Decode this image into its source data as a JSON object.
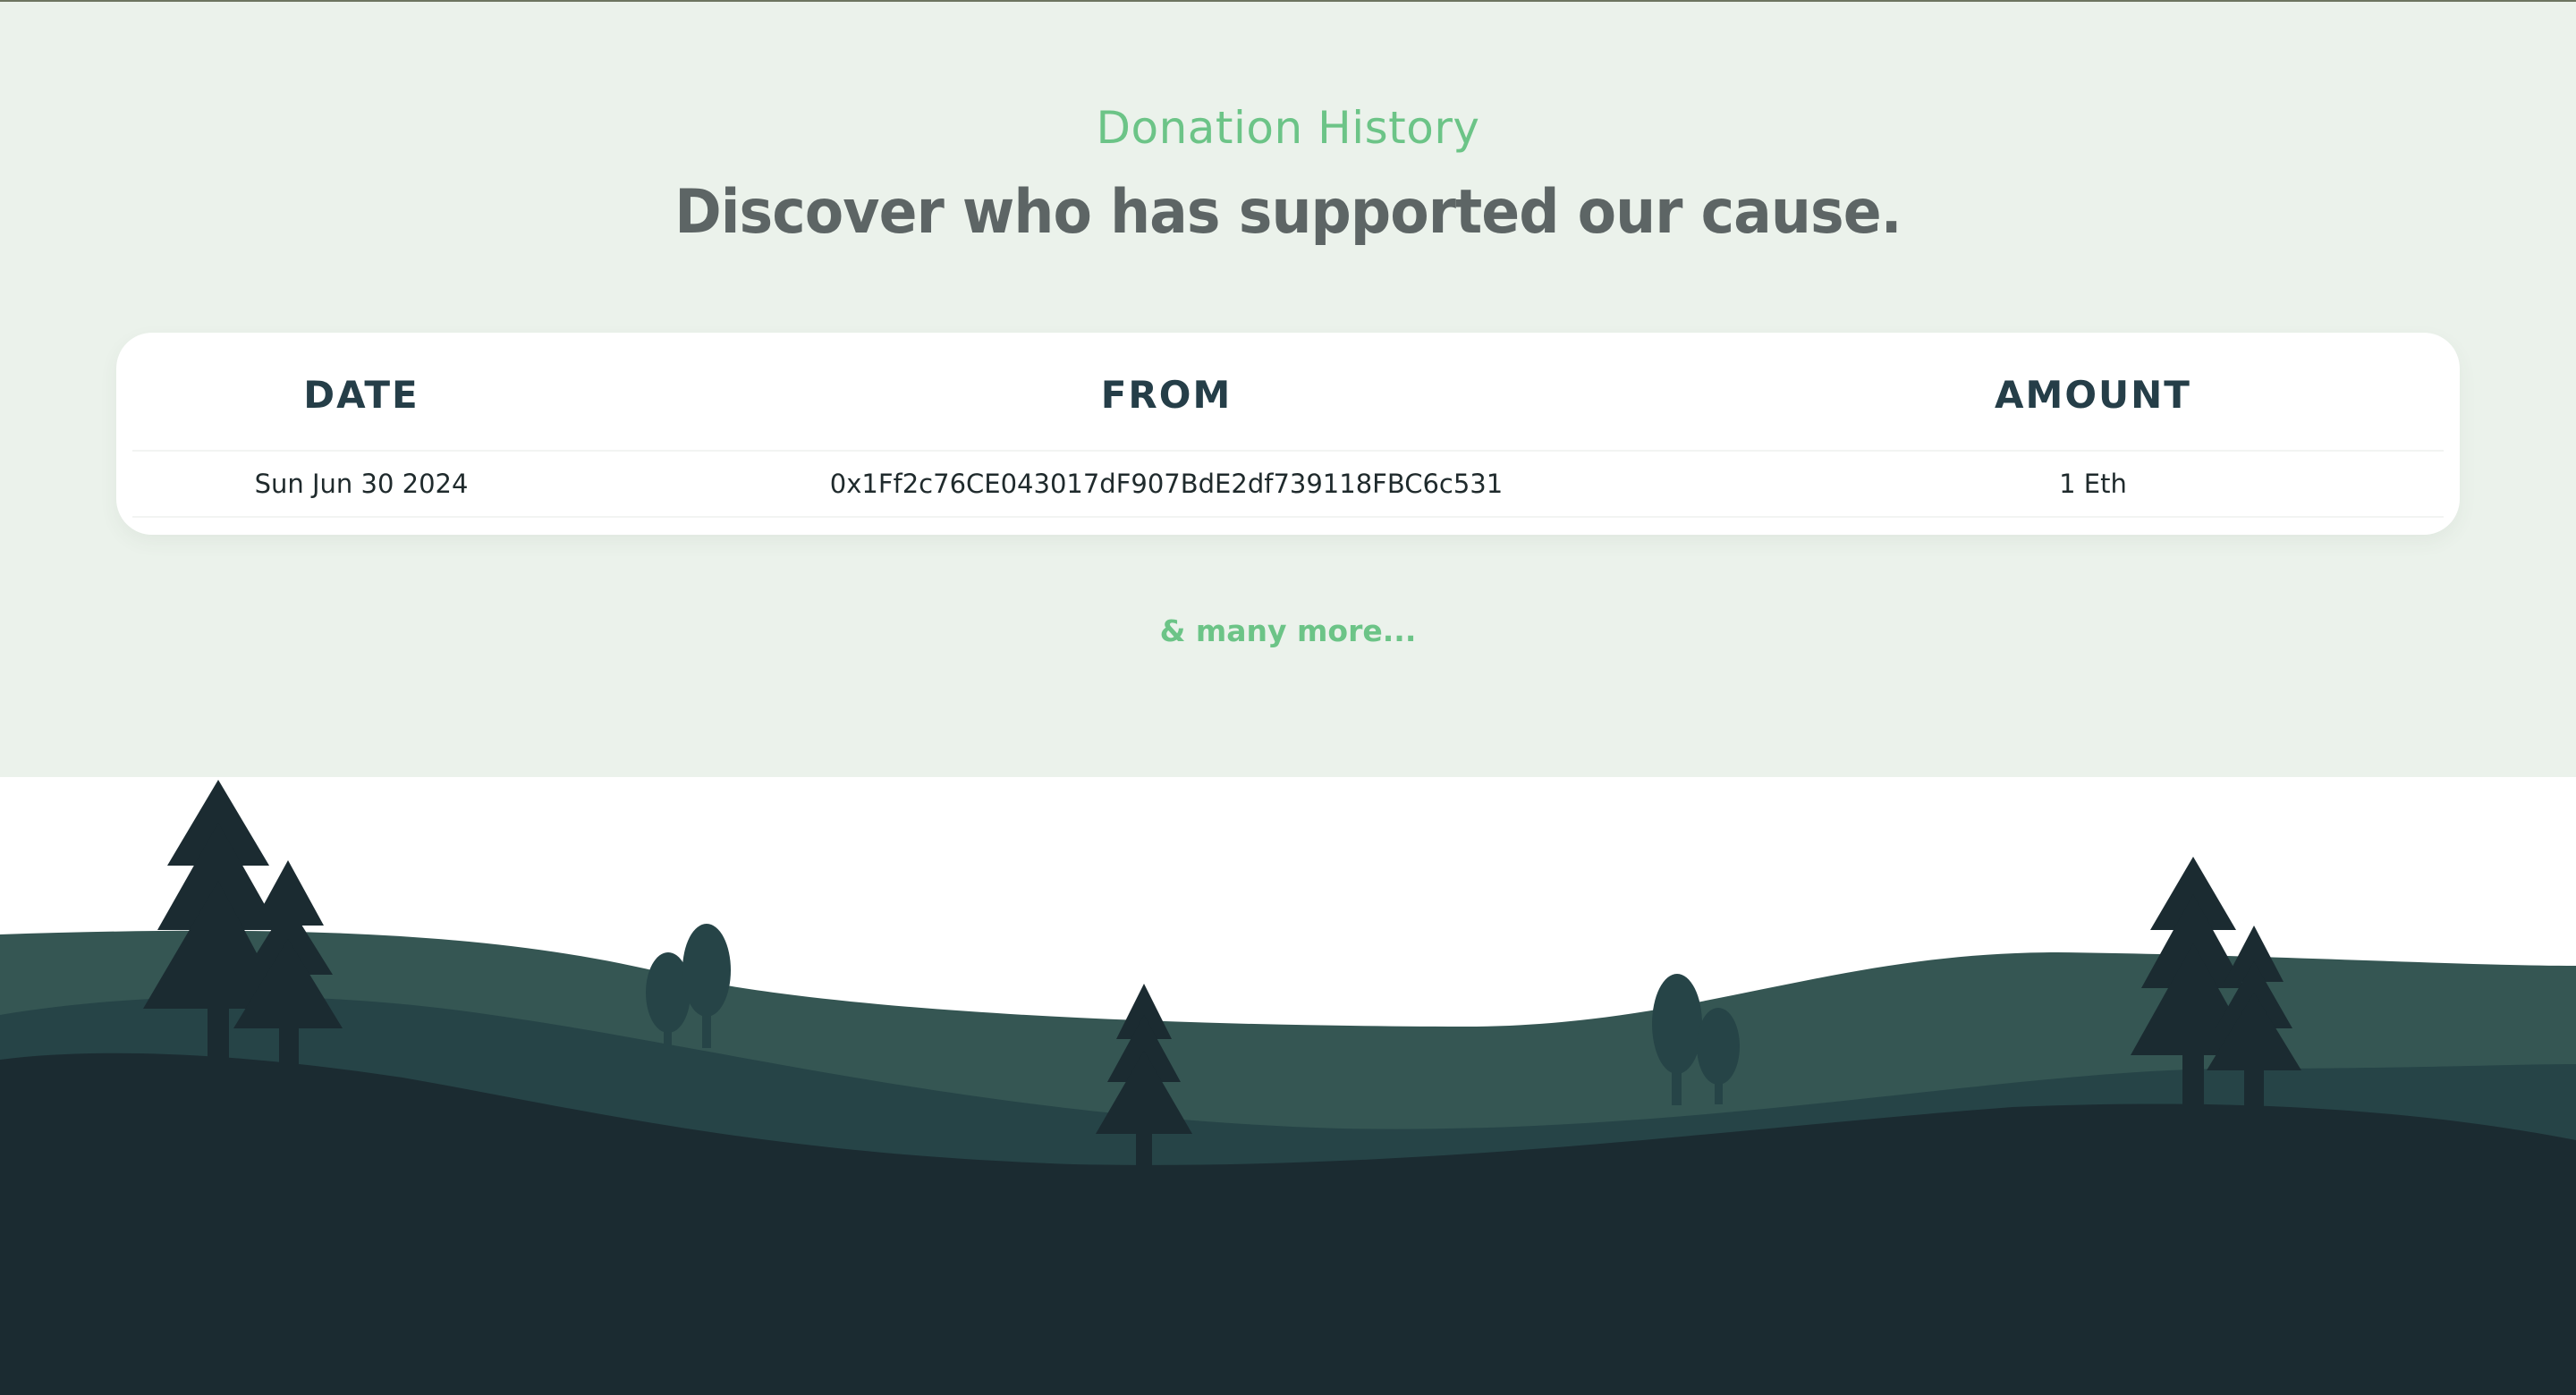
{
  "section": {
    "eyebrow": "Donation History",
    "headline": "Discover who has supported our cause."
  },
  "table": {
    "columns": [
      "DATE",
      "FROM",
      "AMOUNT"
    ],
    "rows": [
      {
        "date": "Sun Jun 30 2024",
        "from": "0x1Ff2c76CE043017dF907BdE2df739118FBC6c531",
        "amount": "1 Eth"
      }
    ]
  },
  "more_link": "& many more...",
  "colors": {
    "accent": "#6cc487",
    "headline": "#5d6565",
    "section_bg": "#ebf2eb",
    "table_header": "#253e48",
    "hill_back": "#355653",
    "hill_mid": "#264447",
    "hill_front": "#1b2b31"
  }
}
